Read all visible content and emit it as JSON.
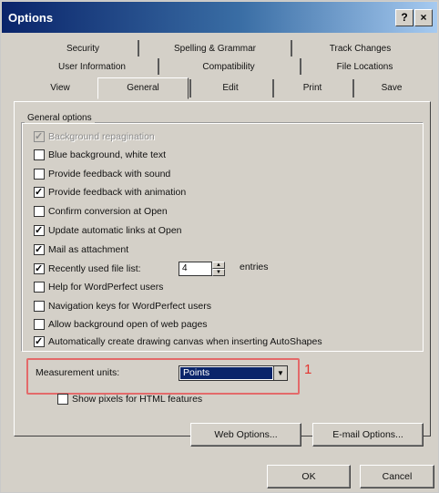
{
  "window": {
    "title": "Options",
    "help_label": "?",
    "close_label": "×"
  },
  "tabs_row1": [
    "Security",
    "Spelling & Grammar",
    "Track Changes"
  ],
  "tabs_row2": [
    "User Information",
    "Compatibility",
    "File Locations"
  ],
  "tabs_row3": [
    "View",
    "General",
    "Edit",
    "Print",
    "Save"
  ],
  "active_tab": "General",
  "group": {
    "label": "General options",
    "options": [
      {
        "label": "Background repagination",
        "checked": true,
        "disabled": true
      },
      {
        "label": "Blue background, white text",
        "checked": false,
        "disabled": false
      },
      {
        "label": "Provide feedback with sound",
        "checked": false,
        "disabled": false
      },
      {
        "label": "Provide feedback with animation",
        "checked": true,
        "disabled": false
      },
      {
        "label": "Confirm conversion at Open",
        "checked": false,
        "disabled": false
      },
      {
        "label": "Update automatic links at Open",
        "checked": true,
        "disabled": false
      },
      {
        "label": "Mail as attachment",
        "checked": true,
        "disabled": false
      },
      {
        "label": "Recently used file list:",
        "checked": true,
        "disabled": false
      },
      {
        "label": "Help for WordPerfect users",
        "checked": false,
        "disabled": false
      },
      {
        "label": "Navigation keys for WordPerfect users",
        "checked": false,
        "disabled": false
      },
      {
        "label": "Allow background open of web pages",
        "checked": false,
        "disabled": false
      },
      {
        "label": "Automatically create drawing canvas when inserting AutoShapes",
        "checked": true,
        "disabled": false
      }
    ],
    "recent_files_count": "4",
    "entries_label": "entries"
  },
  "measurement": {
    "label": "Measurement units:",
    "value": "Points"
  },
  "show_pixels": {
    "label": "Show pixels for HTML features",
    "checked": false
  },
  "annotation": "1",
  "buttons": {
    "web_options": "Web Options...",
    "email_options": "E-mail Options...",
    "ok": "OK",
    "cancel": "Cancel"
  },
  "colors": {
    "title_gradient_start": "#0a246a",
    "dialog_bg": "#d4d0c8",
    "highlight_border": "#e36a6a",
    "annotation": "#e3342f",
    "selection": "#0a246a"
  }
}
